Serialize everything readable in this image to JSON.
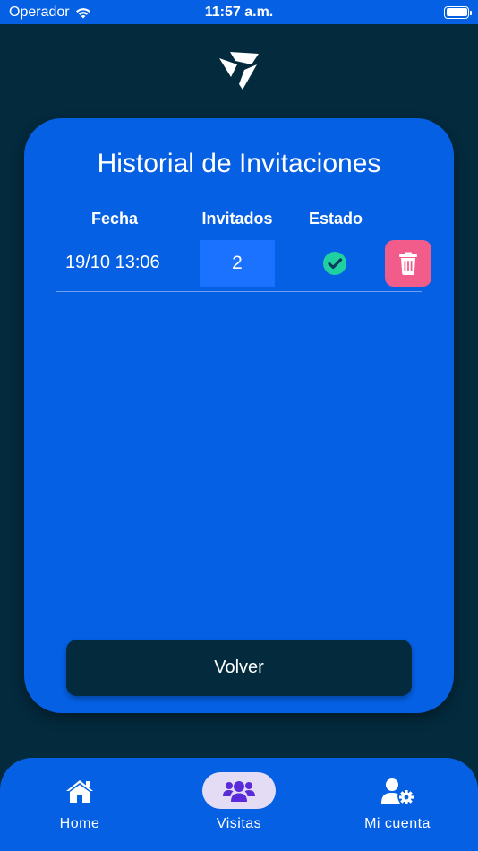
{
  "status_bar": {
    "carrier": "Operador",
    "time": "11:57 a.m."
  },
  "card": {
    "title": "Historial de Invitaciones",
    "columns": [
      "Fecha",
      "Invitados",
      "Estado"
    ],
    "rows": [
      {
        "date": "19/10 13:06",
        "guests": "2",
        "status_icon": "check-circle-icon"
      }
    ],
    "back_label": "Volver"
  },
  "tabs": [
    {
      "label": "Home",
      "icon": "home-icon",
      "active": false
    },
    {
      "label": "Visitas",
      "icon": "users-icon",
      "active": true
    },
    {
      "label": "Mi cuenta",
      "icon": "user-gear-icon",
      "active": false
    }
  ],
  "colors": {
    "background": "#032a3d",
    "primary": "#0560e3",
    "delete": "#f25c8a",
    "status_ok": "#1fd1a0",
    "active_tab": "#e4dcf5",
    "active_tab_icon": "#5a2bd8"
  }
}
